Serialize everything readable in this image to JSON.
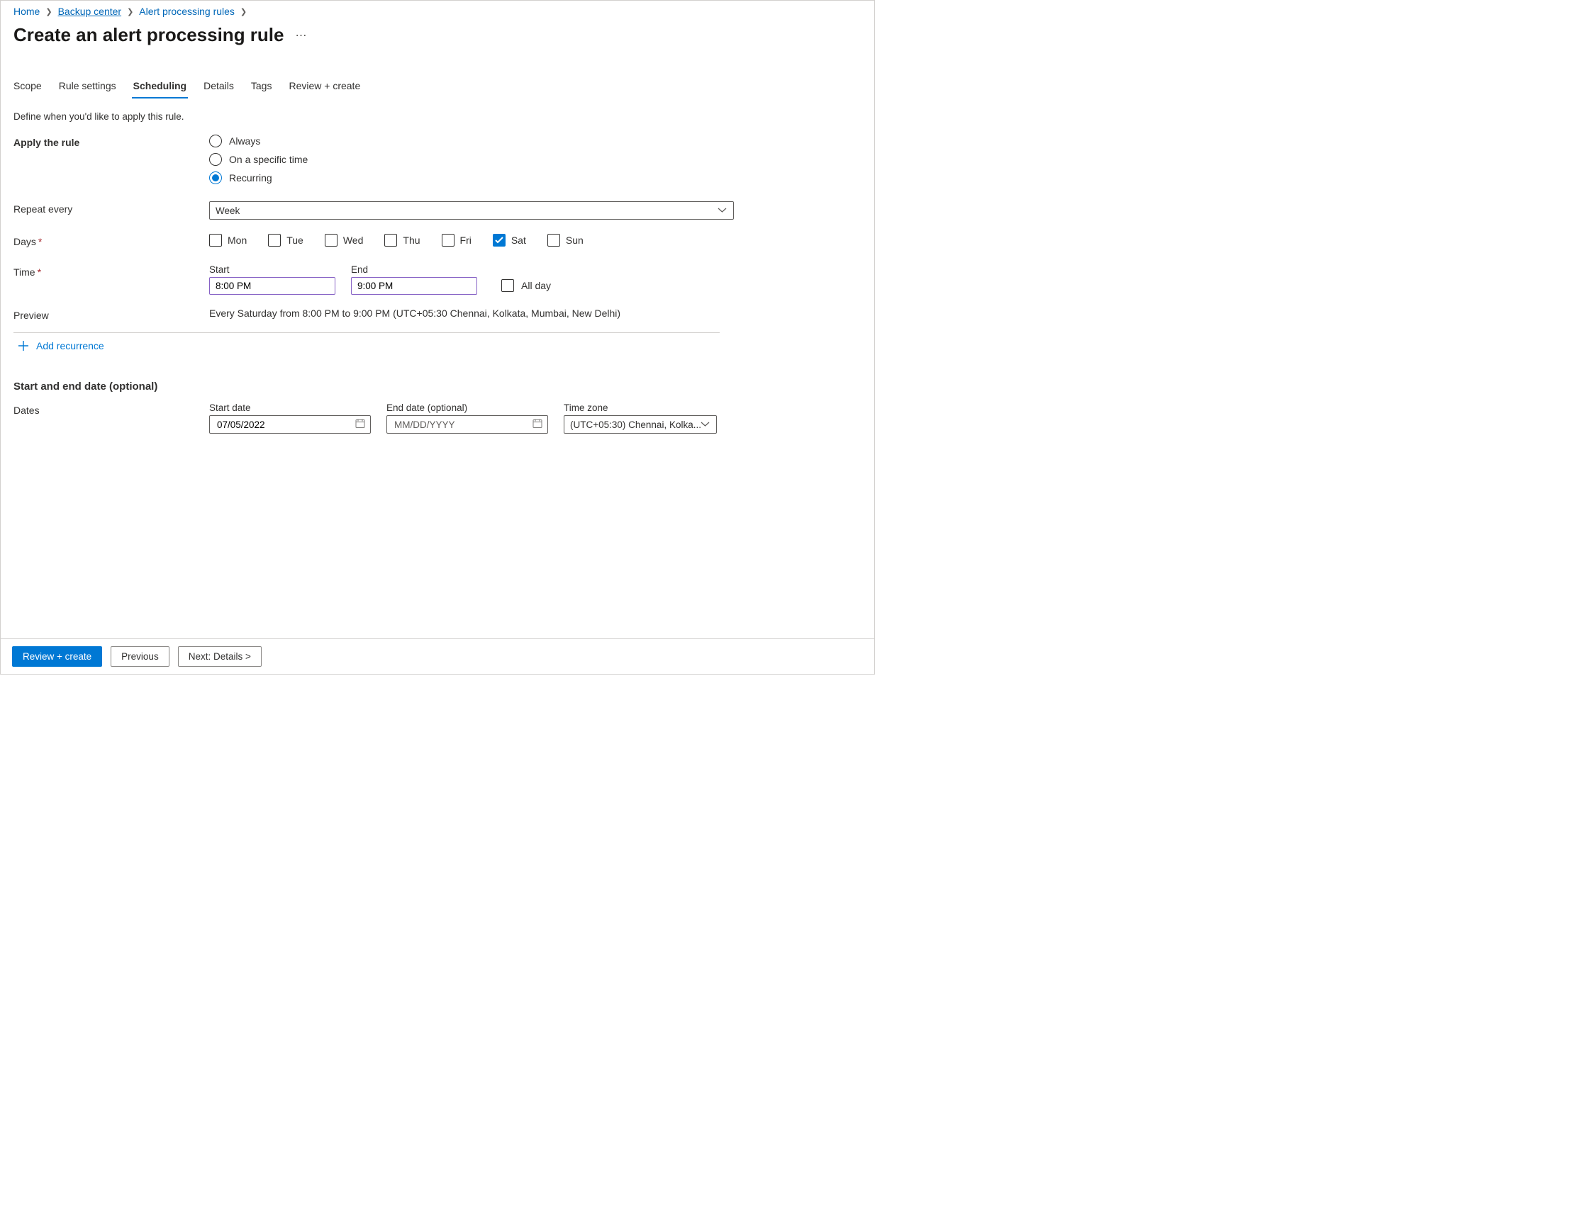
{
  "breadcrumb": {
    "items": [
      "Home",
      "Backup center",
      "Alert processing rules"
    ],
    "underlined_index": 1
  },
  "page_title": "Create an alert processing rule",
  "tabs": {
    "items": [
      "Scope",
      "Rule settings",
      "Scheduling",
      "Details",
      "Tags",
      "Review + create"
    ],
    "active_index": 2
  },
  "description": "Define when you'd like to apply this rule.",
  "apply_rule": {
    "label": "Apply the rule",
    "options": [
      "Always",
      "On a specific time",
      "Recurring"
    ],
    "selected_index": 2
  },
  "repeat_every": {
    "label": "Repeat every",
    "value": "Week"
  },
  "days": {
    "label": "Days",
    "items": [
      "Mon",
      "Tue",
      "Wed",
      "Thu",
      "Fri",
      "Sat",
      "Sun"
    ],
    "checked": [
      false,
      false,
      false,
      false,
      false,
      false,
      false
    ],
    "checked_index": 5
  },
  "time": {
    "label": "Time",
    "start_label": "Start",
    "end_label": "End",
    "start_value": "8:00 PM",
    "end_value": "9:00 PM",
    "all_day_label": "All day",
    "all_day_checked": false
  },
  "preview": {
    "label": "Preview",
    "text": "Every Saturday from 8:00 PM to 9:00 PM (UTC+05:30 Chennai, Kolkata, Mumbai, New Delhi)"
  },
  "add_recurrence_label": "Add recurrence",
  "section_dates_title": "Start and end date (optional)",
  "dates": {
    "label": "Dates",
    "start_label": "Start date",
    "start_value": "07/05/2022",
    "end_label": "End date (optional)",
    "end_placeholder": "MM/DD/YYYY",
    "end_value": "",
    "tz_label": "Time zone",
    "tz_value": "(UTC+05:30) Chennai, Kolka..."
  },
  "footer": {
    "review": "Review + create",
    "previous": "Previous",
    "next": "Next: Details >"
  }
}
